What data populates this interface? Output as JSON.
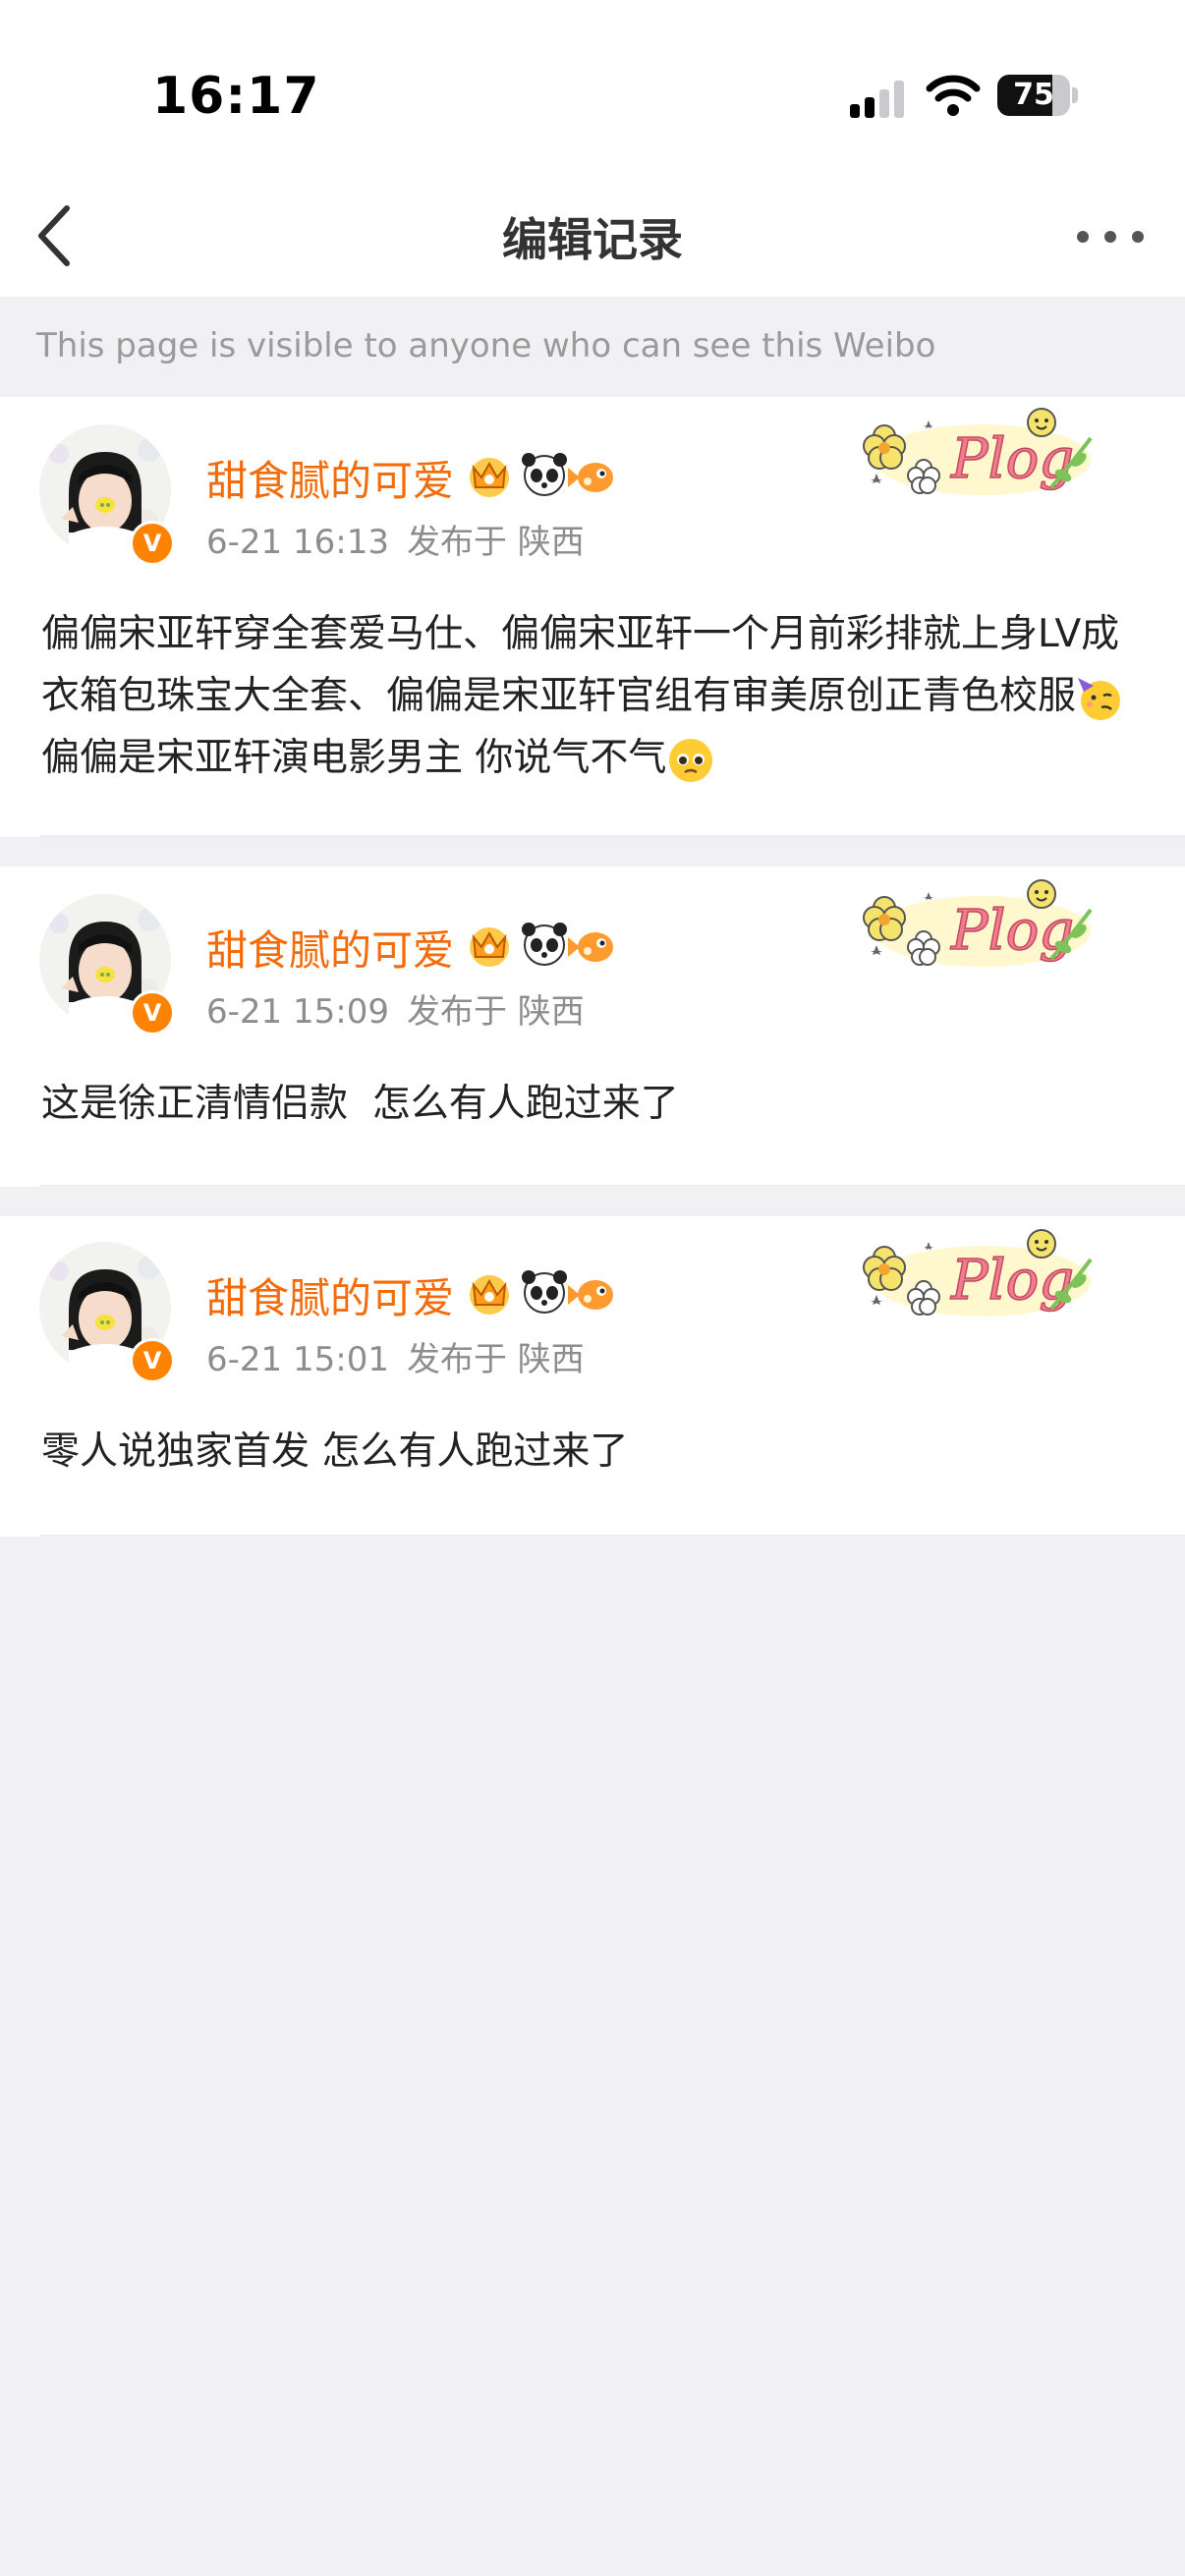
{
  "status": {
    "time": "16:17",
    "battery": "75",
    "battery_level": 0.75
  },
  "nav": {
    "title": "编辑记录",
    "back_icon": "chevron-left-icon",
    "more_icon": "more-horizontal-icon"
  },
  "notice": "This page is visible to anyone who can see this Weibo",
  "colors": {
    "username": "#f46b0a",
    "verified_badge": "#ff8200",
    "meta": "#8d8d8d",
    "background": "#f1f1f4"
  },
  "records": [
    {
      "username": "甜食腻的可爱",
      "time": "6-21 16:13",
      "location": "发布于 陕西",
      "text_parts": [
        "偏偏宋亚轩穿全套爱马仕、偏偏宋亚轩一个月前彩排就上身LV成衣箱包珠宝大全套、偏偏是宋亚轩官组有审美原创正青色校服",
        "偏偏是宋亚轩演电影男主 你说气不气"
      ]
    },
    {
      "username": "甜食腻的可爱",
      "time": "6-21 15:09",
      "location": "发布于 陕西",
      "text_parts": [
        "这是徐正清情侣款  怎么有人跑过来了"
      ]
    },
    {
      "username": "甜食腻的可爱",
      "time": "6-21 15:01",
      "location": "发布于 陕西",
      "text_parts": [
        "零人说独家首发 怎么有人跑过来了"
      ]
    }
  ],
  "decor": {
    "plog_label": "Plog",
    "verified_label": "V"
  }
}
